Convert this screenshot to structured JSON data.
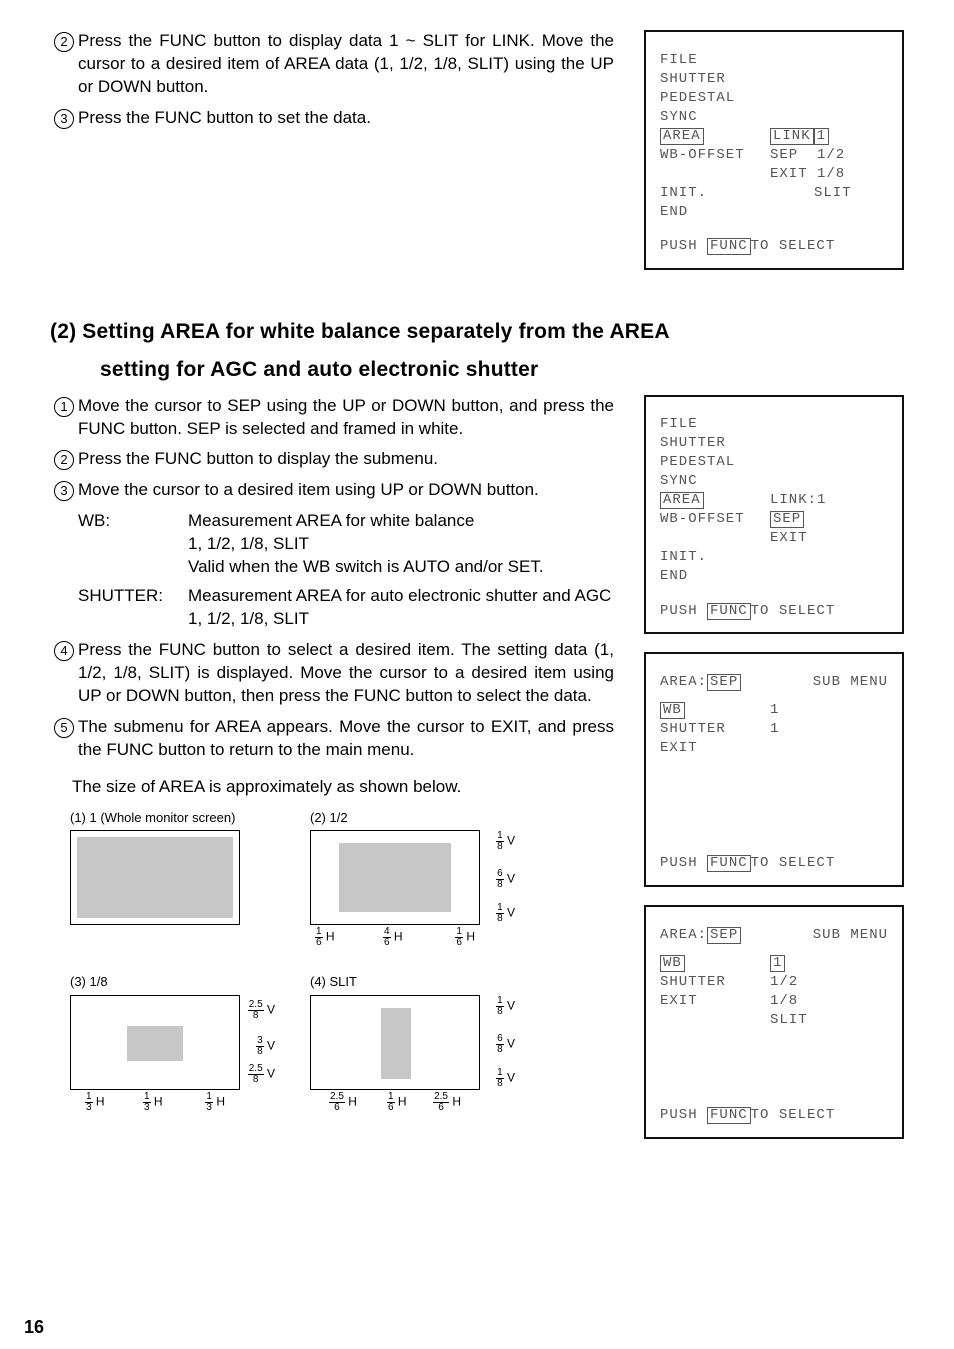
{
  "top_steps": {
    "s2": "Press the FUNC button to display data 1 ~ SLIT for LINK. Move the cursor to a desired item of AREA data (1, 1/2, 1/8, SLIT) using the UP or DOWN button.",
    "s3": "Press the FUNC button to set the data."
  },
  "menu1": {
    "l1": "FILE",
    "l2": "SHUTTER",
    "l3": "PEDESTAL",
    "l4": "SYNC",
    "l5a": "AREA",
    "l5b": "LINK",
    "l5c": "1",
    "l6a": "WB-OFFSET",
    "l6b": "SEP  1/2",
    "l7b": "EXIT 1/8",
    "l8a": "INIT.",
    "l8b": "SLIT",
    "l9": "END",
    "footer_push": "PUSH",
    "footer_func": "FUNC",
    "footer_rest": " TO SELECT"
  },
  "section_title_line1": "(2) Setting AREA for white balance separately from the AREA",
  "section_title_line2": "setting for AGC and auto electronic shutter",
  "mid_steps": {
    "s1": "Move the cursor to SEP using the UP or DOWN button, and press the FUNC button. SEP is selected and framed in white.",
    "s2": "Press the FUNC button to display the submenu.",
    "s3": "Move the cursor to a desired item using UP or DOWN button.",
    "wb_label": "WB:",
    "wb_body1": "Measurement AREA for white balance",
    "wb_body2": "1, 1/2, 1/8, SLIT",
    "wb_body3": "Valid when the WB switch is AUTO and/or SET.",
    "sh_label": "SHUTTER:",
    "sh_body1": "Measurement AREA for auto electronic shutter and AGC",
    "sh_body2": "1, 1/2, 1/8, SLIT",
    "s4": "Press the FUNC button to select a desired item. The setting data (1, 1/2, 1/8, SLIT) is displayed. Move the cursor to a desired item using UP or DOWN button, then press the FUNC button to select the data.",
    "s5": "The submenu for AREA appears. Move the cursor to EXIT, and press the FUNC button to return to the main menu."
  },
  "menu2": {
    "l1": "FILE",
    "l2": "SHUTTER",
    "l3": "PEDESTAL",
    "l4": "SYNC",
    "l5a": "AREA",
    "l5b": "LINK:1",
    "l6a": "WB-OFFSET",
    "l6b": "SEP",
    "l7b": "EXIT",
    "l8": "INIT.",
    "l9": "END"
  },
  "menu3": {
    "header_a": "AREA:",
    "header_b": "SEP",
    "header_c": "SUB MENU",
    "l1a": "WB",
    "l1b": "1",
    "l2a": "SHUTTER",
    "l2b": "1",
    "l3": "EXIT"
  },
  "menu4": {
    "header_a": "AREA:",
    "header_b": "SEP",
    "header_c": "SUB MENU",
    "l1a": "WB",
    "l1b": "1",
    "l2a": "SHUTTER",
    "l2b": "1/2",
    "l3a": "EXIT",
    "l3b": "1/8",
    "l4b": "SLIT"
  },
  "size_note": "The size of AREA is approximately as shown below.",
  "diagrams": {
    "d1": "(1) 1 (Whole monitor screen)",
    "d2": "(2) 1/2",
    "d3": "(3) 1/8",
    "d4": "(4) SLIT"
  },
  "fractions": {
    "v18": {
      "n": "1",
      "d": "8"
    },
    "v68": {
      "n": "6",
      "d": "8"
    },
    "h16": {
      "n": "1",
      "d": "6"
    },
    "h46": {
      "n": "4",
      "d": "6"
    },
    "v258": {
      "n": "2.5",
      "d": "8"
    },
    "v38": {
      "n": "3",
      "d": "8"
    },
    "h13": {
      "n": "1",
      "d": "3"
    },
    "h256": {
      "n": "2.5",
      "d": "6"
    }
  },
  "V": "V",
  "H": "H",
  "page_number": "16"
}
